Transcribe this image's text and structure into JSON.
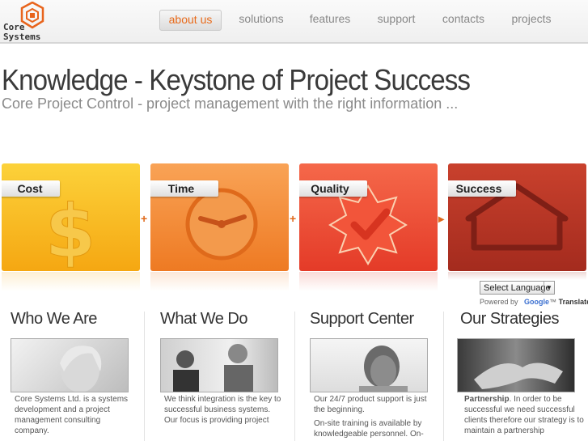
{
  "logo": {
    "line1": "Core",
    "line2": "Systems"
  },
  "nav": [
    {
      "label": "about us",
      "active": true
    },
    {
      "label": "solutions",
      "active": false
    },
    {
      "label": "features",
      "active": false
    },
    {
      "label": "support",
      "active": false
    },
    {
      "label": "contacts",
      "active": false
    },
    {
      "label": "projects",
      "active": false
    }
  ],
  "hero": {
    "title": "Knowledge - Keystone of Project Success",
    "subtitle": "Core Project Control - project management with the right information ..."
  },
  "cards": [
    {
      "label": "Cost",
      "icon": "dollar-icon",
      "color": "#f7b315"
    },
    {
      "label": "Time",
      "icon": "clock-icon",
      "color": "#f0852e"
    },
    {
      "label": "Quality",
      "icon": "badge-check-icon",
      "color": "#e9462d"
    },
    {
      "label": "Success",
      "icon": "house-icon",
      "color": "#b73324"
    }
  ],
  "separators": [
    "+",
    "+",
    "▸"
  ],
  "translate": {
    "select_label": "Select Language",
    "powered_by": "Powered by",
    "brand": "Google",
    "translate": "Translate"
  },
  "columns": [
    {
      "title": "Who We Are",
      "text": "Core Systems Ltd. is a systems development and a project management consulting company."
    },
    {
      "title": "What We Do",
      "text": "We think integration is the key to successful business systems.",
      "text2": "Our focus is providing project"
    },
    {
      "title": "Support Center",
      "text": "Our 24/7 product support is just the beginning.",
      "text2": "On-site training is available by knowledgeable personnel. On-"
    },
    {
      "title": "Our Strategies",
      "bold": "Partnership",
      "text": ". In order to be successful we need successful clients therefore our strategy is to maintain a partnership"
    }
  ]
}
